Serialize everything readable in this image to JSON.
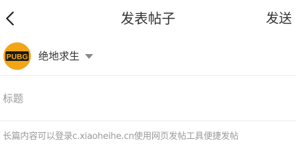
{
  "header": {
    "back_icon": "chevron-left-icon",
    "title": "发表帖子",
    "send_label": "发送"
  },
  "game": {
    "avatar_text": "PUBG",
    "name": "绝地求生",
    "caret_icon": "caret-down-icon"
  },
  "title_field": {
    "placeholder": "标题",
    "value": ""
  },
  "content_field": {
    "placeholder": "长篇内容可以登录c.xiaoheihe.cn使用网页发帖工具便捷发帖",
    "value": ""
  },
  "colors": {
    "background": "#ffffff",
    "text": "#333333",
    "placeholder": "#9b9b9b",
    "divider": "#ececec",
    "avatar_bg": "#f2a515"
  }
}
